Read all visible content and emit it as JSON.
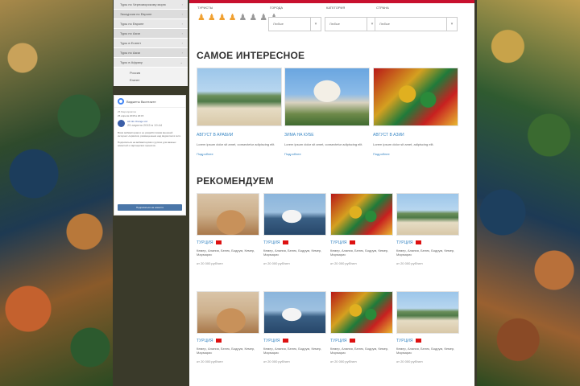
{
  "sidebar": {
    "menu": [
      {
        "label": "Туры по Черноморскому морю"
      },
      {
        "label": "Экскурсии по Европе"
      },
      {
        "label": "Туры по Европе"
      },
      {
        "label": "Туры по Азии"
      },
      {
        "label": "Туры в Египет"
      },
      {
        "label": "Туры по Азии"
      },
      {
        "label": "Туры в Африку"
      }
    ],
    "submenu": [
      {
        "label": "Россия"
      },
      {
        "label": "Египет"
      }
    ]
  },
  "widget": {
    "title": "Виджеты Вконтакте",
    "subtitle": "25 Мероприятия",
    "date": "25 апреля 2015 в 20:15",
    "post_author": "All info Orange Ltd",
    "post_date": "25 апреля 2015 в 19:44",
    "text1": "Всем вебмастерам и ее разработчикам внешней интернет-сервисов, размещенным над виджетом в сети.",
    "text2": "Подписаться на вебмастерских группах для важных новостей и партнерских проектов.",
    "button": "Подписаться на новости"
  },
  "filters": {
    "tourists_label": "ТУРИСТЫ",
    "countries_label": "ГОРОДА",
    "category_label": "КАТЕГОРИЯ",
    "class_label": "СТРАНА",
    "select1": "Любые",
    "select2": "Любые",
    "select3": "Любые"
  },
  "sections": {
    "interesting": "САМОЕ ИНТЕРЕСНОЕ",
    "recommend": "РЕКОМЕНДУЕМ"
  },
  "interesting_cards": [
    {
      "title": "АВГУСТ В АРАБИИ",
      "text": "Lorem ipsum dolor sit amet, consectetur adipiscing elit.",
      "link": "Подробнее"
    },
    {
      "title": "ЗИМА НА КУБЕ",
      "text": "Lorem ipsum dolor sit amet, consectetur adipiscing elit.",
      "link": "Подробнее"
    },
    {
      "title": "АВГУСТ В АЗИИ",
      "text": "Lorem ipsum dolor sit amet, adipiscing elit.",
      "link": "Подробнее"
    }
  ],
  "recommend_cards": [
    {
      "title": "ТУРЦИЯ",
      "text": "Кемер, Алания, Белек, Бодрум, Кемер, Мармарис",
      "price": "от 20 000 руб/чел"
    },
    {
      "title": "ТУРЦИЯ",
      "text": "Кемер, Алания, Белек, Бодрум, Кемер, Мармарис",
      "price": "от 20 000 руб/чел"
    },
    {
      "title": "ТУРЦИЯ",
      "text": "Кемер, Алания, Белек, Бодрум, Кемер, Мармарис",
      "price": "от 20 000 руб/чел"
    },
    {
      "title": "ТУРЦИЯ",
      "text": "Кемер, Алания, Белек, Бодрум, Кемер, Мармарис",
      "price": "от 20 000 руб/чел"
    },
    {
      "title": "ТУРЦИЯ",
      "text": "Кемер, Алания, Белек, Бодрум, Кемер, Мармарис",
      "price": "от 20 000 руб/чел"
    },
    {
      "title": "ТУРЦИЯ",
      "text": "Кемер, Алания, Белек, Бодрум, Кемер, Мармарис",
      "price": "от 20 000 руб/чел"
    },
    {
      "title": "ТУРЦИЯ",
      "text": "Кемер, Алания, Белек, Бодрум, Кемер, Мармарис",
      "price": "от 20 000 руб/чел"
    },
    {
      "title": "ТУРЦИЯ",
      "text": "Кемер, Алания, Белек, Бодрум, Кемер, Мармарис",
      "price": "от 20 000 руб/чел"
    }
  ],
  "colors": {
    "accent": "#c8102e",
    "link": "#3a87c4",
    "person_active": "#f0a030"
  },
  "icons": {
    "person": "person-icon",
    "chevron": "chevron-down-icon",
    "flag": "flag-icon"
  }
}
